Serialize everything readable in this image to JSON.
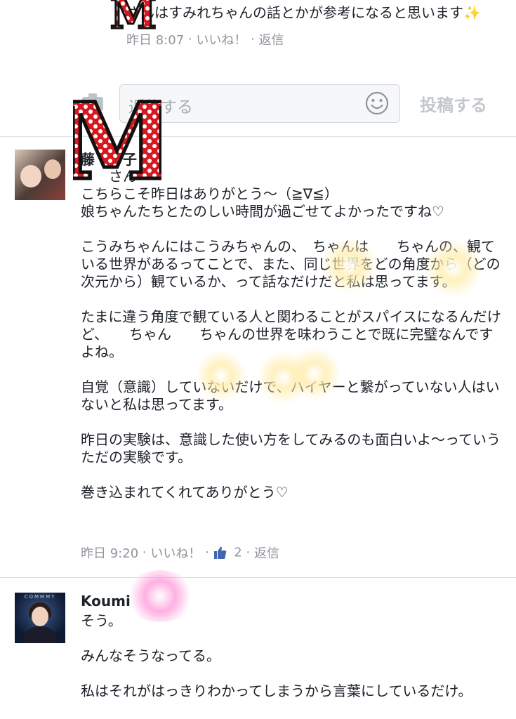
{
  "top_reply": {
    "text": "さんはすみれちゃんの話とかが参考になると思います✨",
    "time": "昨日 8:07",
    "like_label": "いいね！",
    "reply_label": "返信"
  },
  "reply_box": {
    "placeholder": "返信する",
    "post_label": "投稿する"
  },
  "comments": [
    {
      "author": "藤　　子",
      "body": "　　さん\nこちらこそ昨日はありがとう〜（≧∇≦）\n娘ちゃんたちとたのしい時間が過ごせてよかったですね♡\n\nこうみちゃんにはこうみちゃんの、　ちゃんは　　ちゃんの、観ている世界があるってことで、また、同じ世界をどの角度から（どの次元から）観ているか、って話なだけだと私は思ってます。\n\nたまに違う角度で観ている人と関わることがスパイスになるんだけど、　　ちゃん　　ちゃんの世界を味わうことで既に完璧なんですよね。\n\n自覚（意識）していないだけで、ハイヤーと繋がっていない人はいないと私は思ってます。\n\n昨日の実験は、意識した使い方をしてみるのも面白いよ〜っていうただの実験です。\n\n巻き込まれてくれてありがとう♡",
      "time": "昨日 9:20",
      "like_label": "いいね！",
      "like_count": "2",
      "reply_label": "返信"
    },
    {
      "author": "Koumi",
      "avatar_text": "COMMMY",
      "body": "そう。\n\nみんなそうなってる。\n\n私はそれがはっきりわかってしまうから言葉にしているだけ。"
    }
  ],
  "sticker_letter": "M",
  "colors": {
    "sticker_red": "#d81820",
    "meta_gray": "#90949c",
    "like_blue": "#4267b2"
  }
}
